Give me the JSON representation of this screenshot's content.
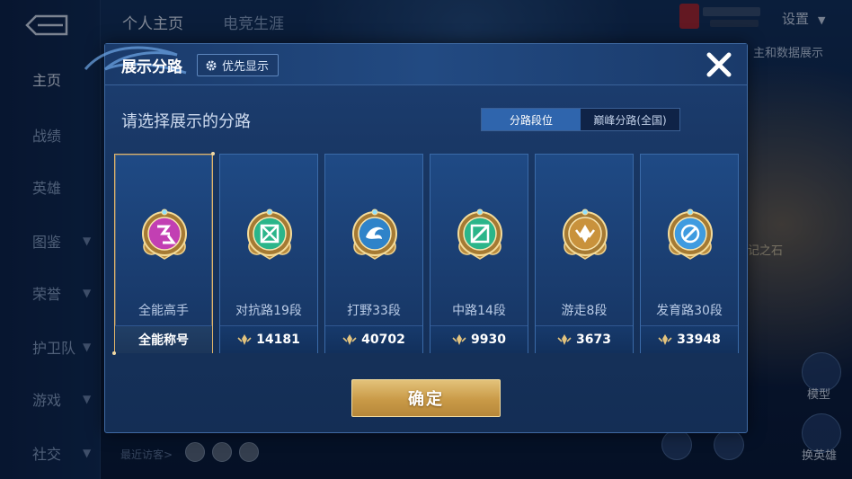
{
  "background": {
    "sidebar": {
      "items": [
        {
          "label": "主页",
          "active": true,
          "has_chevron": false
        },
        {
          "label": "战绩",
          "active": false,
          "has_chevron": false
        },
        {
          "label": "英雄",
          "active": false,
          "has_chevron": false
        },
        {
          "label": "图鉴",
          "active": false,
          "has_chevron": true
        },
        {
          "label": "荣誉",
          "active": false,
          "has_chevron": true
        },
        {
          "label": "护卫队",
          "active": false,
          "has_chevron": true
        },
        {
          "label": "游戏",
          "active": false,
          "has_chevron": true
        },
        {
          "label": "社交",
          "active": false,
          "has_chevron": true
        }
      ]
    },
    "top_tabs": [
      "个人主页",
      "电竞生涯"
    ],
    "settings_label": "设置",
    "right_panel_text": "主和数据展示",
    "right_panel_text2": "记之石",
    "right_buttons": [
      "模型",
      "换英雄"
    ],
    "visitor_label": "最近访客>"
  },
  "modal": {
    "title": "展示分路",
    "priority_label": "优先显示",
    "subtitle": "请选择展示的分路",
    "toggle": {
      "options": [
        "分路段位",
        "巅峰分路(全国)"
      ],
      "selected": 0
    },
    "cards": [
      {
        "name": "全能高手",
        "footer": "全能称号",
        "has_points": false,
        "selected": true,
        "emblem_color": "#c23fb3",
        "emblem": "all-round-emblem-icon"
      },
      {
        "name": "对抗路19段",
        "footer": "14181",
        "has_points": true,
        "selected": false,
        "emblem_color": "#2bb58a",
        "emblem": "clash-lane-emblem-icon"
      },
      {
        "name": "打野33段",
        "footer": "40702",
        "has_points": true,
        "selected": false,
        "emblem_color": "#2f83c9",
        "emblem": "jungle-emblem-icon"
      },
      {
        "name": "中路14段",
        "footer": "9930",
        "has_points": true,
        "selected": false,
        "emblem_color": "#2bb58a",
        "emblem": "mid-lane-emblem-icon"
      },
      {
        "name": "游走8段",
        "footer": "3673",
        "has_points": true,
        "selected": false,
        "emblem_color": "#c9923c",
        "emblem": "roam-emblem-icon"
      },
      {
        "name": "发育路30段",
        "footer": "33948",
        "has_points": true,
        "selected": false,
        "emblem_color": "#3f9be0",
        "emblem": "farm-lane-emblem-icon"
      }
    ],
    "confirm_label": "确定"
  },
  "colors": {
    "accent_blue": "#2f65ad",
    "gold": "#e1b56a",
    "panel": "#1d3f73"
  }
}
